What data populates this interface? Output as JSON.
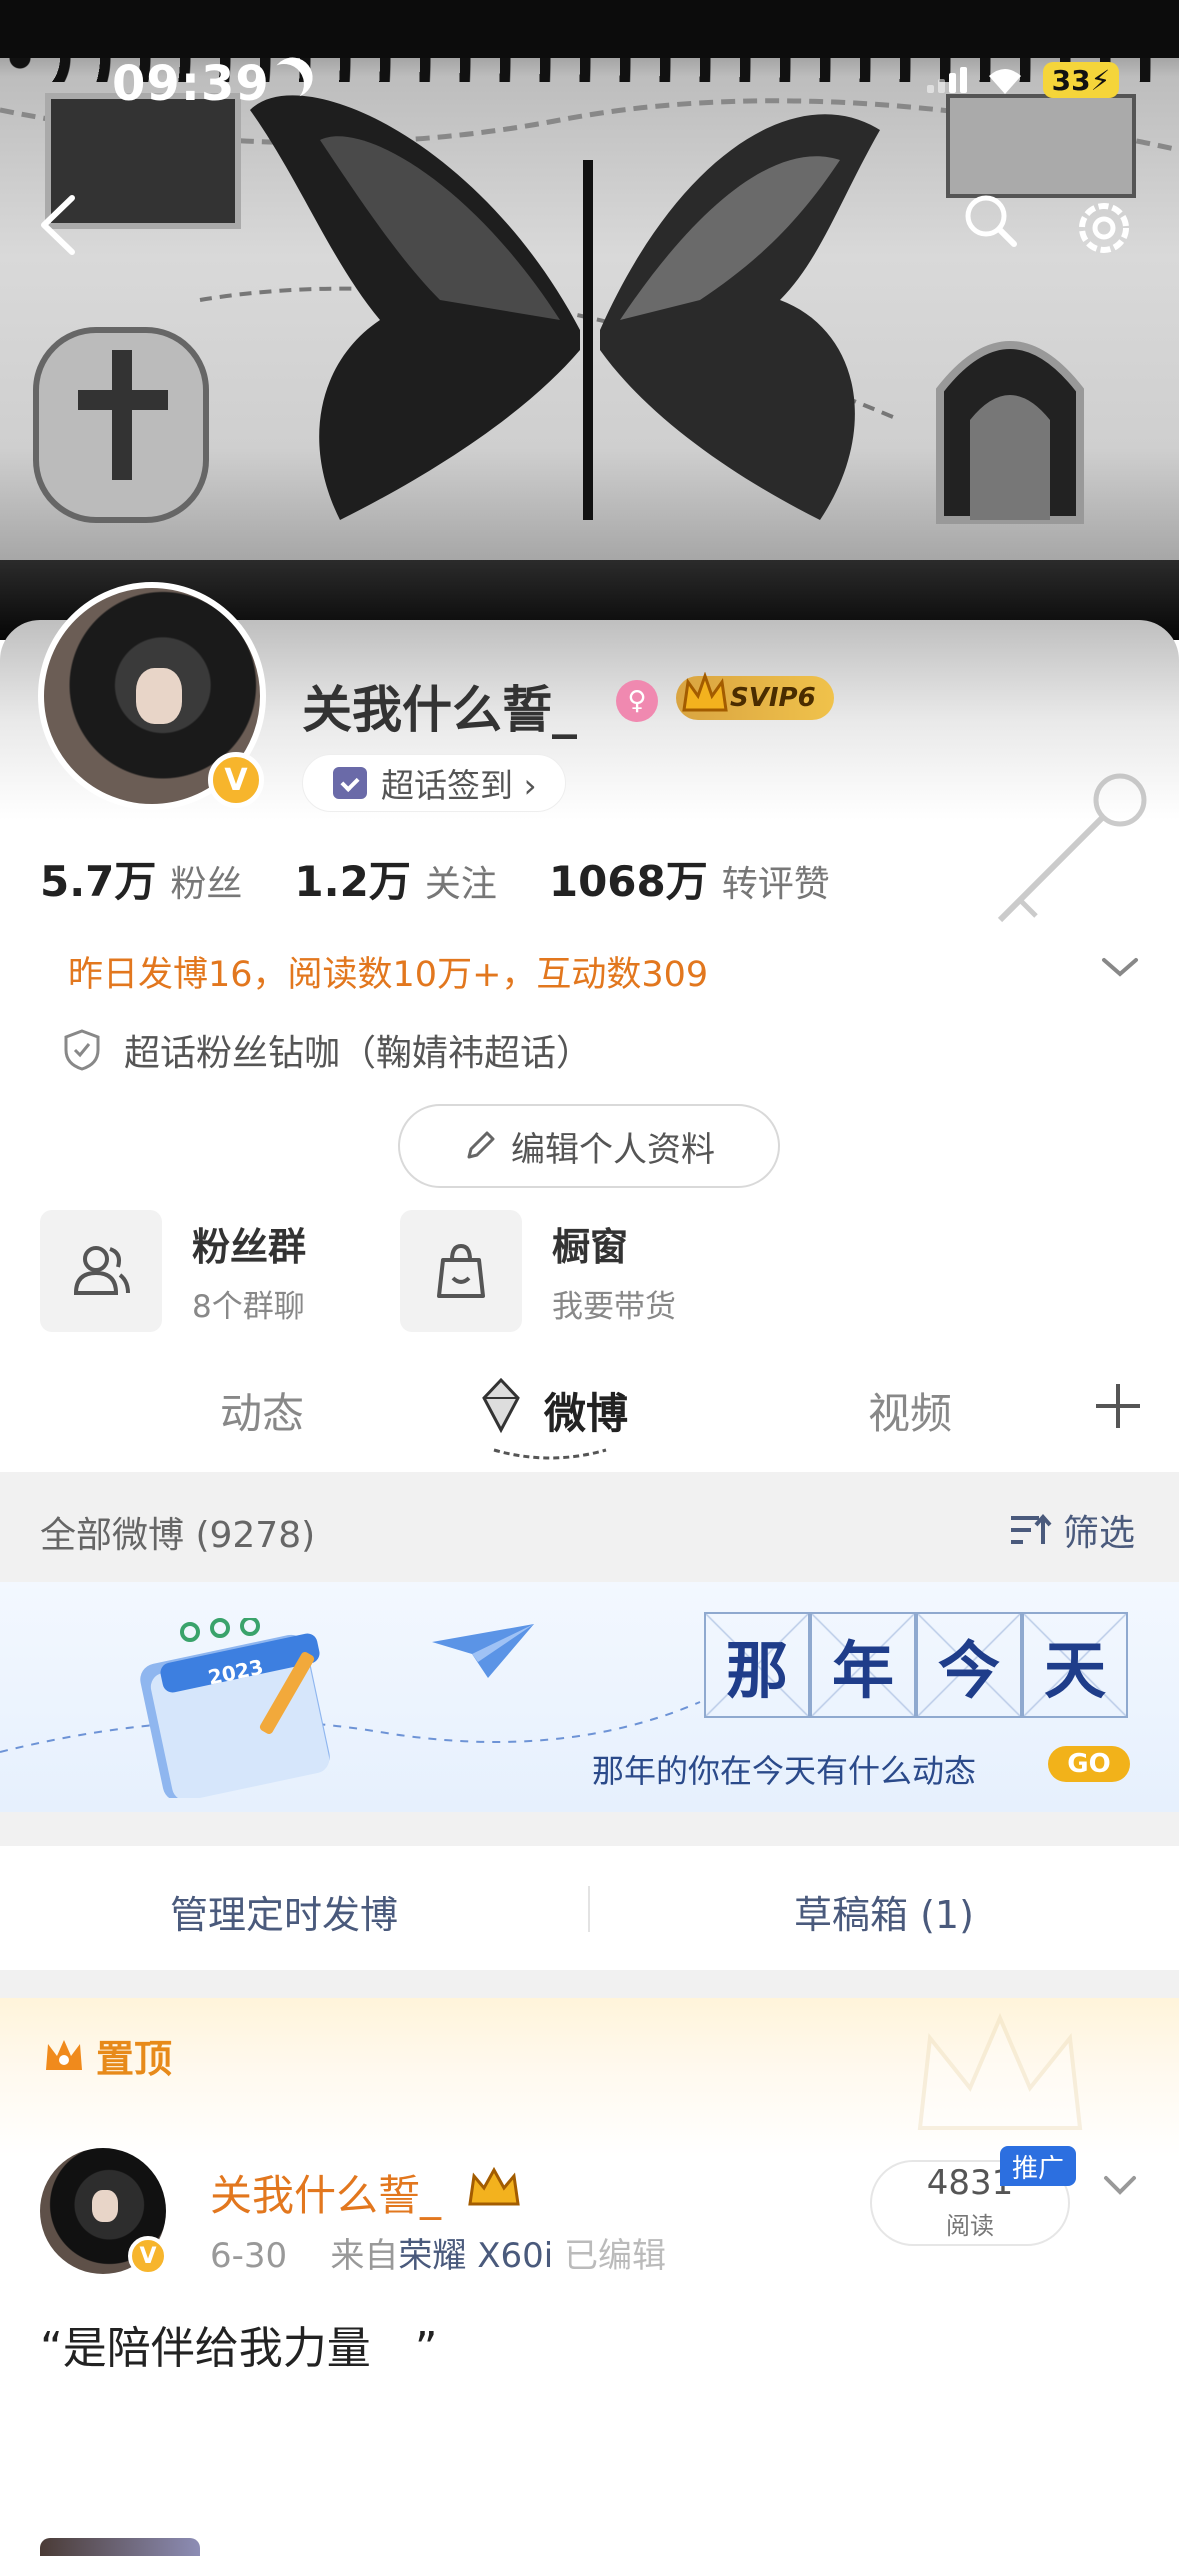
{
  "status_bar": {
    "time": "09:39",
    "battery": "33"
  },
  "profile": {
    "nickname": "关我什么誓_",
    "svip_label": "SVIP6",
    "chaohua_checkin": "超话签到 ›",
    "verified_mark": "V",
    "stats": [
      {
        "value": "5.7万",
        "label": "粉丝"
      },
      {
        "value": "1.2万",
        "label": "关注"
      },
      {
        "value": "1068万",
        "label": "转评赞"
      }
    ],
    "yesterday_summary": "昨日发博16，阅读数10万+，互动数309",
    "fan_title": "超话粉丝钻咖（鞠婧祎超话）",
    "edit_button": "编辑个人资料"
  },
  "tiles": [
    {
      "title": "粉丝群",
      "subtitle": "8个群聊",
      "icon": "group-icon"
    },
    {
      "title": "橱窗",
      "subtitle": "我要带货",
      "icon": "shopping-bag-icon"
    }
  ],
  "tabs": [
    "动态",
    "微博",
    "视频"
  ],
  "active_tab": "微博",
  "list_header": {
    "count_label": "全部微博 (9278)",
    "filter_label": "筛选"
  },
  "anniversary": {
    "title_chars": [
      "那",
      "年",
      "今",
      "天"
    ],
    "subtitle": "那年的你在今天有什么动态",
    "go_label": "GO",
    "calendar_year": "2023"
  },
  "manage": {
    "scheduled": "管理定时发博",
    "drafts": "草稿箱 (1)"
  },
  "pinned_post": {
    "section_label": "置顶",
    "author": "关我什么誓_",
    "date": "6-30",
    "source_prefix": "来自",
    "source_device": "荣耀 X60i",
    "source_suffix": "已编辑",
    "read_count": "4831",
    "read_label": "阅读",
    "promo_tag": "推广",
    "text": "“是陪伴给我力量　”"
  },
  "colors": {
    "accent_orange": "#e2771e",
    "link_blue": "#4a5a7c",
    "svip_gold": "#f0c24b",
    "verified_yellow": "#f7b52c",
    "promo_blue": "#2c6fe0"
  }
}
